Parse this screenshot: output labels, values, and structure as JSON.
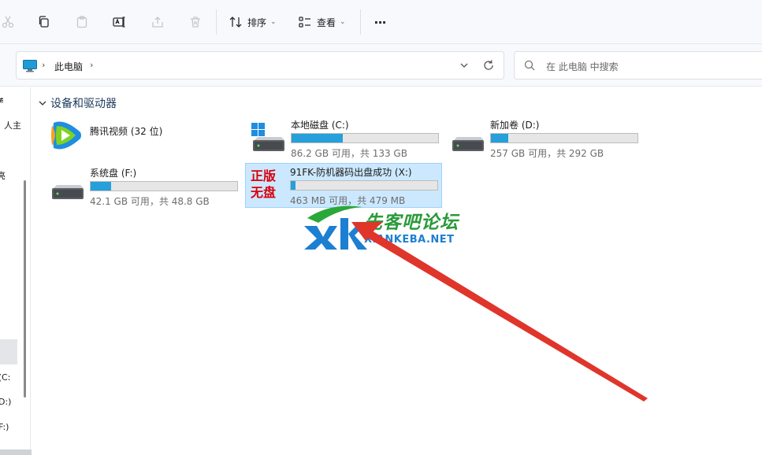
{
  "toolbar": {
    "sort_label": "排序",
    "view_label": "查看",
    "more_label": "···"
  },
  "address": {
    "path_label": "此电脑",
    "separator": "›"
  },
  "search": {
    "placeholder": "在 此电脑 中搜索"
  },
  "nav": {
    "items": [
      "≢",
      "、人主",
      "亮",
      ":(C:",
      "D:)",
      "F:)"
    ]
  },
  "section": {
    "title": "设备和驱动器"
  },
  "drives": [
    {
      "name": "腾讯视频 (32 位)",
      "type": "app"
    },
    {
      "name": "本地磁盘 (C:)",
      "size": "86.2 GB 可用，共 133 GB",
      "used_fraction": 0.35,
      "type": "system"
    },
    {
      "name": "新加卷 (D:)",
      "size": "257 GB 可用，共 292 GB",
      "used_fraction": 0.12,
      "type": "disk"
    },
    {
      "name": "系统盘 (F:)",
      "size": "42.1 GB 可用，共 48.8 GB",
      "used_fraction": 0.14,
      "type": "disk"
    },
    {
      "name": "91FK-防机器码出盘成功 (X:)",
      "size": "463 MB 可用，共 479 MB",
      "used_fraction": 0.03,
      "type": "disk",
      "selected": true
    }
  ],
  "stamp": {
    "line1": "正版",
    "line2": "无盘"
  },
  "watermark": {
    "logo_letters": "XK",
    "cn": "先客吧论坛",
    "en": "XIANKEBA.NET"
  },
  "colors": {
    "accent": "#26a0da",
    "selection_bg": "#cce8ff",
    "stamp": "#d9000d",
    "arrow": "#e0352b",
    "watermark_green": "#2a9a3a",
    "watermark_blue": "#1c7fd2"
  }
}
